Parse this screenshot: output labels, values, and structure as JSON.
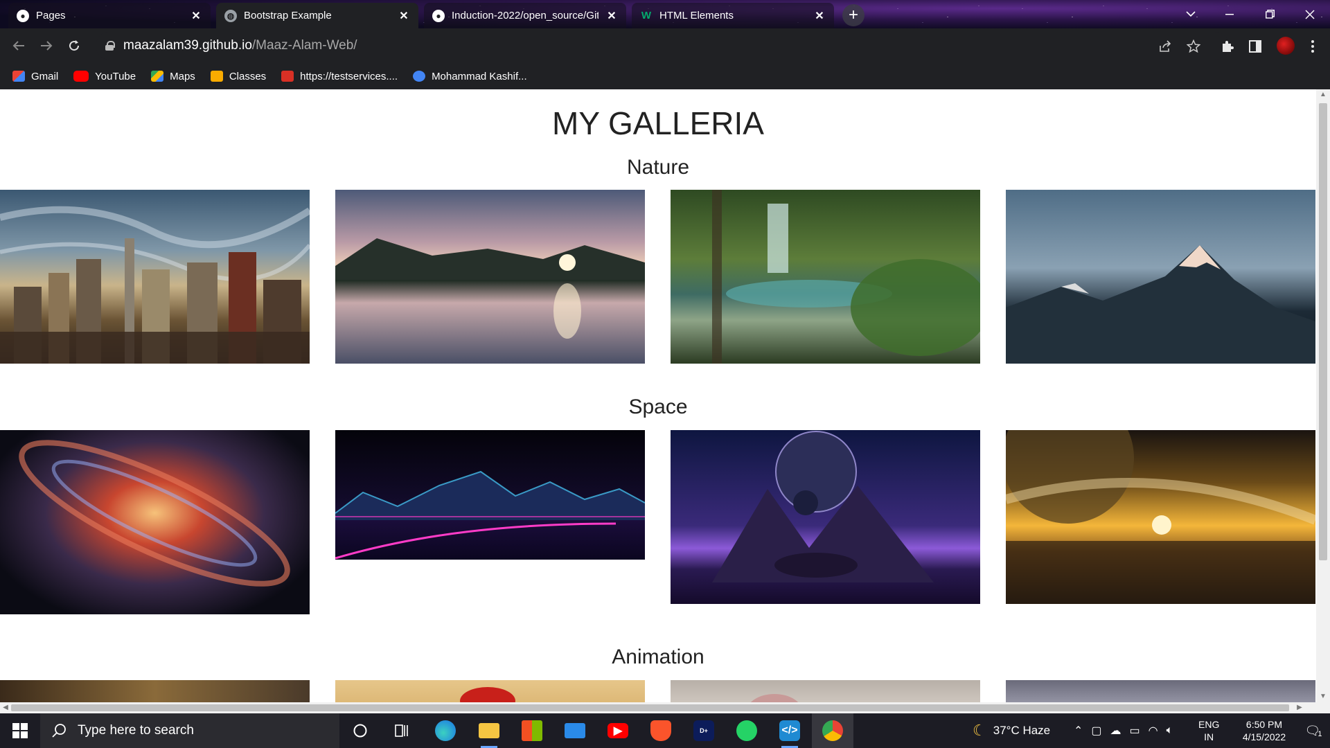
{
  "tabs": [
    {
      "title": "Pages",
      "favicon": "github-icon",
      "state": "inactive"
    },
    {
      "title": "Bootstrap Example",
      "favicon": "globe-icon",
      "state": "active"
    },
    {
      "title": "Induction-2022/open_source/Git",
      "favicon": "github-icon",
      "state": "inactive"
    },
    {
      "title": "HTML Elements",
      "favicon": "w3schools-icon",
      "state": "inactive"
    }
  ],
  "tab_close_glyph": "✕",
  "new_tab_glyph": "+",
  "address": {
    "domain": "maazalam39.github.io",
    "path": "/Maaz-Alam-Web/"
  },
  "bookmarks": [
    {
      "label": "Gmail",
      "color": "#ea4335"
    },
    {
      "label": "YouTube",
      "color": "#ff0000"
    },
    {
      "label": "Maps",
      "color": "#34a853"
    },
    {
      "label": "Classes",
      "color": "#f9ab00"
    },
    {
      "label": "https://testservices....",
      "color": "#d93025"
    },
    {
      "label": "Mohammad Kashif...",
      "color": "#4285f4"
    }
  ],
  "page": {
    "title": "MY GALLERIA",
    "sections": [
      "Nature",
      "Space",
      "Animation"
    ]
  },
  "taskbar": {
    "search_placeholder": "Type here to search",
    "weather": "37°C  Haze",
    "lang_top": "ENG",
    "lang_bottom": "IN",
    "time": "6:50 PM",
    "date": "4/15/2022",
    "notification_count": "1"
  },
  "colors": {
    "chrome_bg": "#202124",
    "taskbar_bg": "#1c1c24",
    "accent": "#6aa6ff"
  }
}
